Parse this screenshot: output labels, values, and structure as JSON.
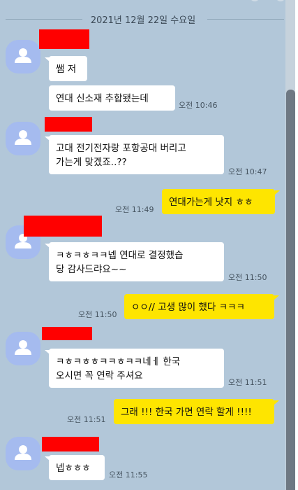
{
  "date_divider": "2021년 12월 22일 수요일",
  "messages": [
    {
      "text": "쌤 저",
      "time": ""
    },
    {
      "text": "연대 신소재 추합됐는데",
      "time": "오전 10:46"
    },
    {
      "text": "고대 전기전자랑 포항공대 버리고\n가는게 맞겠죠..??",
      "time": "오전 10:47"
    },
    {
      "text": "연대가는게 낫지 ㅎㅎ",
      "time": "오전 11:49"
    },
    {
      "text": "ㅋㅎㅋㅎㅋㅋ넵 연대로 결정했습\n당 감사드랴요~~",
      "time": "오전 11:50"
    },
    {
      "text": "ㅇㅇ// 고생 많이 했다 ㅋㅋㅋ",
      "time": "오전 11:50"
    },
    {
      "text": "ㅋㅎㅋㅎㅎㅋㅋㅎㅋㅋ네ㅔ 한국\n오시면 꼭 연락 주셔요",
      "time": "오전 11:51"
    },
    {
      "text": "그래 !!! 한국 가면 연락 할게 !!!!",
      "time": "오전 11:51"
    },
    {
      "text": "넵ㅎㅎㅎ",
      "time": "오전 11:55"
    }
  ],
  "colors": {
    "background": "#b2c7d9",
    "incoming_bubble": "#ffffff",
    "outgoing_bubble": "#fee500",
    "redaction": "#ff0000",
    "avatar": "#a5bbef"
  },
  "icons": {
    "avatar": "default-profile-icon"
  }
}
